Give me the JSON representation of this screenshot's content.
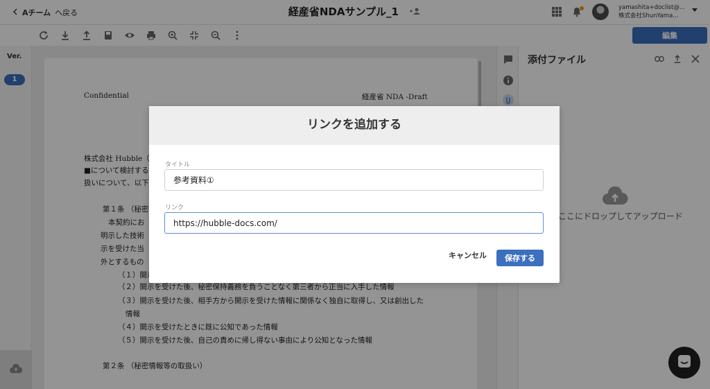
{
  "header": {
    "back_label": "Aチーム",
    "back_link": "へ戻る",
    "doc_title": "経産省NDAサンプル_1",
    "user_email": "yamashita+doclist@...",
    "user_company": "株式会社ShunYama..."
  },
  "toolbar": {
    "icons": [
      "refresh-icon",
      "download-icon",
      "upload-icon",
      "save-icon",
      "preview-icon",
      "print-icon",
      "zoom-in-icon",
      "fit-icon",
      "zoom-out-icon",
      "more-icon"
    ],
    "edit_label": "編集"
  },
  "versions": {
    "label": "Ver.",
    "items": [
      "1"
    ]
  },
  "document": {
    "header_left": "Confidential",
    "header_right": "経産省 NDA -Draft",
    "lines": [
      "株式会社 Hubble（",
      "■について検討する",
      "扱いについて、以下",
      "第１条 （秘密",
      "本契約にお",
      "明示した技術",
      "示を受けた当",
      "外とするもの",
      "（１）開示",
      "（２）開示を受けた後、秘密保持義務を負うことなく第三者から正当に入手した情報",
      "（３）開示を受けた後、相手方から開示を受けた情報に関係なく独自に取得し、又は創出した",
      "情報",
      "（４）開示を受けたときに既に公知であった情報",
      "（５）開示を受けた後、自己の責めに帰し得ない事由により公知となった情報",
      "第２条 （秘密情報等の取扱い）"
    ]
  },
  "attachments": {
    "title": "添付ファイル",
    "drop_text": "ここにドロップしてアップロード"
  },
  "modal": {
    "title": "リンクを追加する",
    "title_field_label": "タイトル",
    "title_field_value": "参考資料①",
    "link_field_label": "リンク",
    "link_field_value": "https://hubble-docs.com/",
    "cancel_label": "キャンセル",
    "save_label": "保存する"
  },
  "colors": {
    "accent": "#3c6fbe",
    "notification": "#f39800"
  }
}
